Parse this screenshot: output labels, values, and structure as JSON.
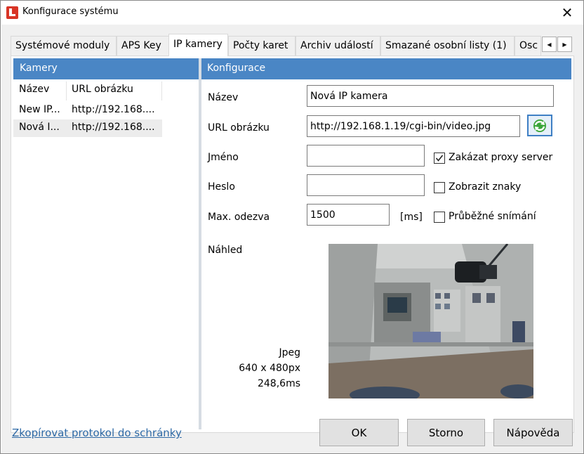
{
  "window": {
    "title": "Konfigurace systému",
    "close_glyph": "✕"
  },
  "tabs": [
    {
      "label": "Systémové moduly",
      "active": false
    },
    {
      "label": "APS Key",
      "active": false
    },
    {
      "label": "IP kamery",
      "active": true
    },
    {
      "label": "Počty karet",
      "active": false
    },
    {
      "label": "Archiv událostí",
      "active": false
    },
    {
      "label": "Smazané osobní listy (1)",
      "active": false
    },
    {
      "label": "Osc",
      "active": false
    }
  ],
  "tab_scroll": {
    "left_glyph": "◀",
    "right_glyph": "▶"
  },
  "cameras": {
    "header": "Kamery",
    "columns": [
      "Název",
      "URL obrázku"
    ],
    "rows": [
      {
        "name": "New IP...",
        "url": "http://192.168....",
        "selected": false
      },
      {
        "name": "Nová I...",
        "url": "http://192.168....",
        "selected": true
      }
    ]
  },
  "config": {
    "header": "Konfigurace",
    "name_label": "Název",
    "name_value": "Nová IP kamera",
    "url_label": "URL obrázku",
    "url_value": "http://192.168.1.19/cgi-bin/video.jpg",
    "user_label": "Jméno",
    "user_value": "",
    "password_label": "Heslo",
    "password_value": "",
    "timeout_label": "Max. odezva",
    "timeout_value": "1500",
    "timeout_unit": "[ms]",
    "disable_proxy": {
      "label": "Zakázat proxy server",
      "checked": true
    },
    "show_chars": {
      "label": "Zobrazit znaky",
      "checked": false
    },
    "continuous": {
      "label": "Průběžné snímání",
      "checked": false
    },
    "preview_label": "Náhled",
    "preview_format": "Jpeg",
    "preview_size": "640 x 480px",
    "preview_time": "248,6ms"
  },
  "footer": {
    "copy_link": "Zkopírovat protokol do schránky",
    "ok": "OK",
    "cancel": "Storno",
    "help": "Nápověda"
  },
  "colors": {
    "pane_header": "#4a86c5",
    "link": "#2f6aa6",
    "refresh_icon": "#3aa53a",
    "window_bg": "#f0f0f0"
  },
  "icons": {
    "app": "app-logo-icon",
    "close": "close-icon",
    "refresh": "refresh-icon",
    "check": "check-icon"
  }
}
